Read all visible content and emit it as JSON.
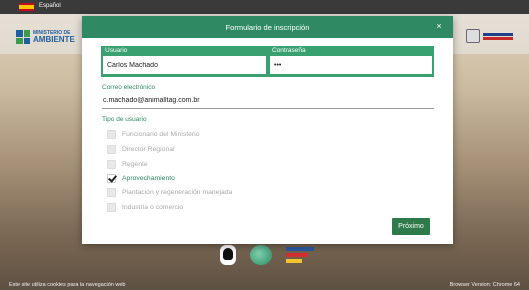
{
  "top_bar": {
    "language": "Español"
  },
  "header": {
    "left_logo": {
      "line1": "MINISTERIO DE",
      "line2": "AMBIENTE"
    }
  },
  "modal": {
    "title": "Formulario de inscripción",
    "close_label": "×",
    "usuario": {
      "label": "Usuario",
      "value": "Carlos Machado"
    },
    "contrasena": {
      "label": "Contraseña",
      "value": "•••"
    },
    "email": {
      "label": "Correo electrónico",
      "value": "c.machado@animalltag.com.br"
    },
    "tipo_label": "Tipo de usuario",
    "options": [
      {
        "label": "Funcionario del Ministerio",
        "checked": false
      },
      {
        "label": "Director Regional",
        "checked": false
      },
      {
        "label": "Regente",
        "checked": false
      },
      {
        "label": "Aprovechamiento",
        "checked": true
      },
      {
        "label": "Plantación y regeneración manejada",
        "checked": false
      },
      {
        "label": "Industria o comercio",
        "checked": false
      }
    ],
    "next_label": "Próximo"
  },
  "footer": {
    "cookies": "Este site utiliza cookies para la navegación web",
    "browser": "Browser Version: Chrome 64"
  },
  "colors": {
    "accent": "#2f8a63",
    "cred_box": "#39a070",
    "button": "#2f7a4a"
  }
}
